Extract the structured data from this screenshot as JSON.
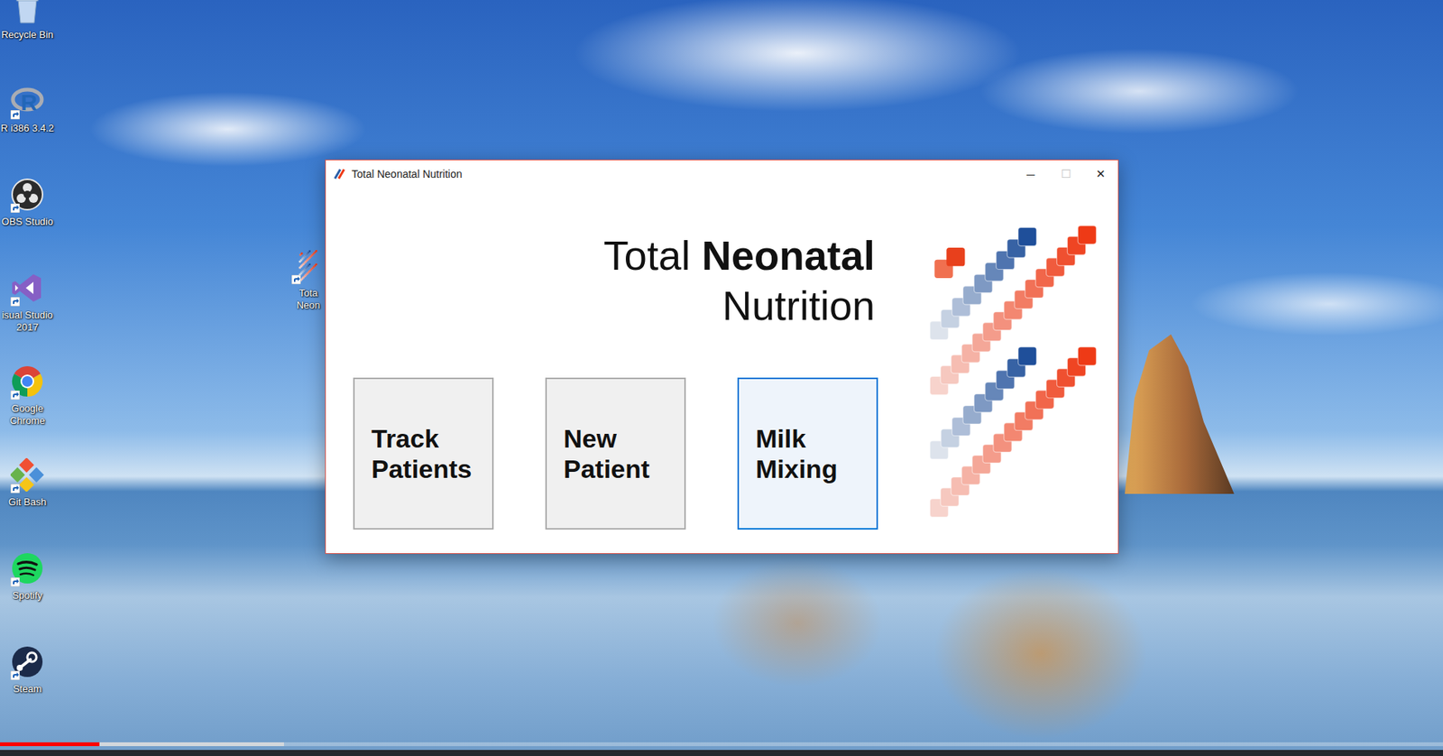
{
  "desktop": {
    "icons": [
      {
        "label": "Recycle Bin",
        "kind": "recycle"
      },
      {
        "label": "R i386 3.4.2",
        "kind": "r",
        "glyph": "R"
      },
      {
        "label": "OBS Studio",
        "kind": "obs"
      },
      {
        "label": "isual Studio 2017",
        "kind": "vs"
      },
      {
        "label": "Google Chrome",
        "kind": "chrome"
      },
      {
        "label": "Git Bash",
        "kind": "git"
      },
      {
        "label": "Spotify",
        "kind": "spotify"
      },
      {
        "label": "Steam",
        "kind": "steam"
      }
    ],
    "hidden_icon": {
      "label": "Tota Neon",
      "kind": "tnn"
    }
  },
  "window": {
    "title": "Total Neonatal Nutrition",
    "controls": [
      {
        "glyph": "─",
        "disabled": false
      },
      {
        "glyph": "☐",
        "disabled": true
      },
      {
        "glyph": "✕",
        "disabled": false
      }
    ],
    "heading": {
      "line1": [
        {
          "text": "Total",
          "bold": false
        },
        {
          "text": "Neonatal",
          "bold": true
        }
      ],
      "line2": "Nutrition"
    },
    "buttons": [
      {
        "label": "Track Patients",
        "selected": false
      },
      {
        "label": "New Patient",
        "selected": false
      },
      {
        "label": "Milk Mixing",
        "selected": true
      }
    ]
  },
  "video_progress": {
    "level": 0.069,
    "buffered": 0.197
  }
}
